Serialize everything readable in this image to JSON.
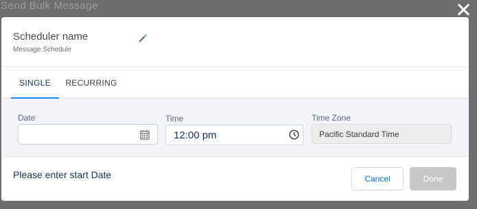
{
  "backdrop": {
    "title": "Send Bulk Message"
  },
  "header": {
    "scheduler_name": "Scheduler name",
    "subtitle": "Message Schedule"
  },
  "tabs": [
    {
      "label": "SINGLE",
      "active": true
    },
    {
      "label": "RECURRING",
      "active": false
    }
  ],
  "form": {
    "date": {
      "label": "Date",
      "value": ""
    },
    "time": {
      "label": "Time",
      "value": "12:00 pm"
    },
    "timezone": {
      "label": "Time Zone",
      "value": "Pacific Standard Time"
    }
  },
  "footer": {
    "message": "Please enter start Date",
    "cancel_label": "Cancel",
    "done_label": "Done"
  },
  "colors": {
    "accent": "#1589ee",
    "link": "#0070d2",
    "disabled_button": "#c9c7c5"
  },
  "icons": {
    "close": "close-icon",
    "edit": "pencil-icon",
    "calendar": "calendar-icon",
    "clock": "clock-icon"
  }
}
